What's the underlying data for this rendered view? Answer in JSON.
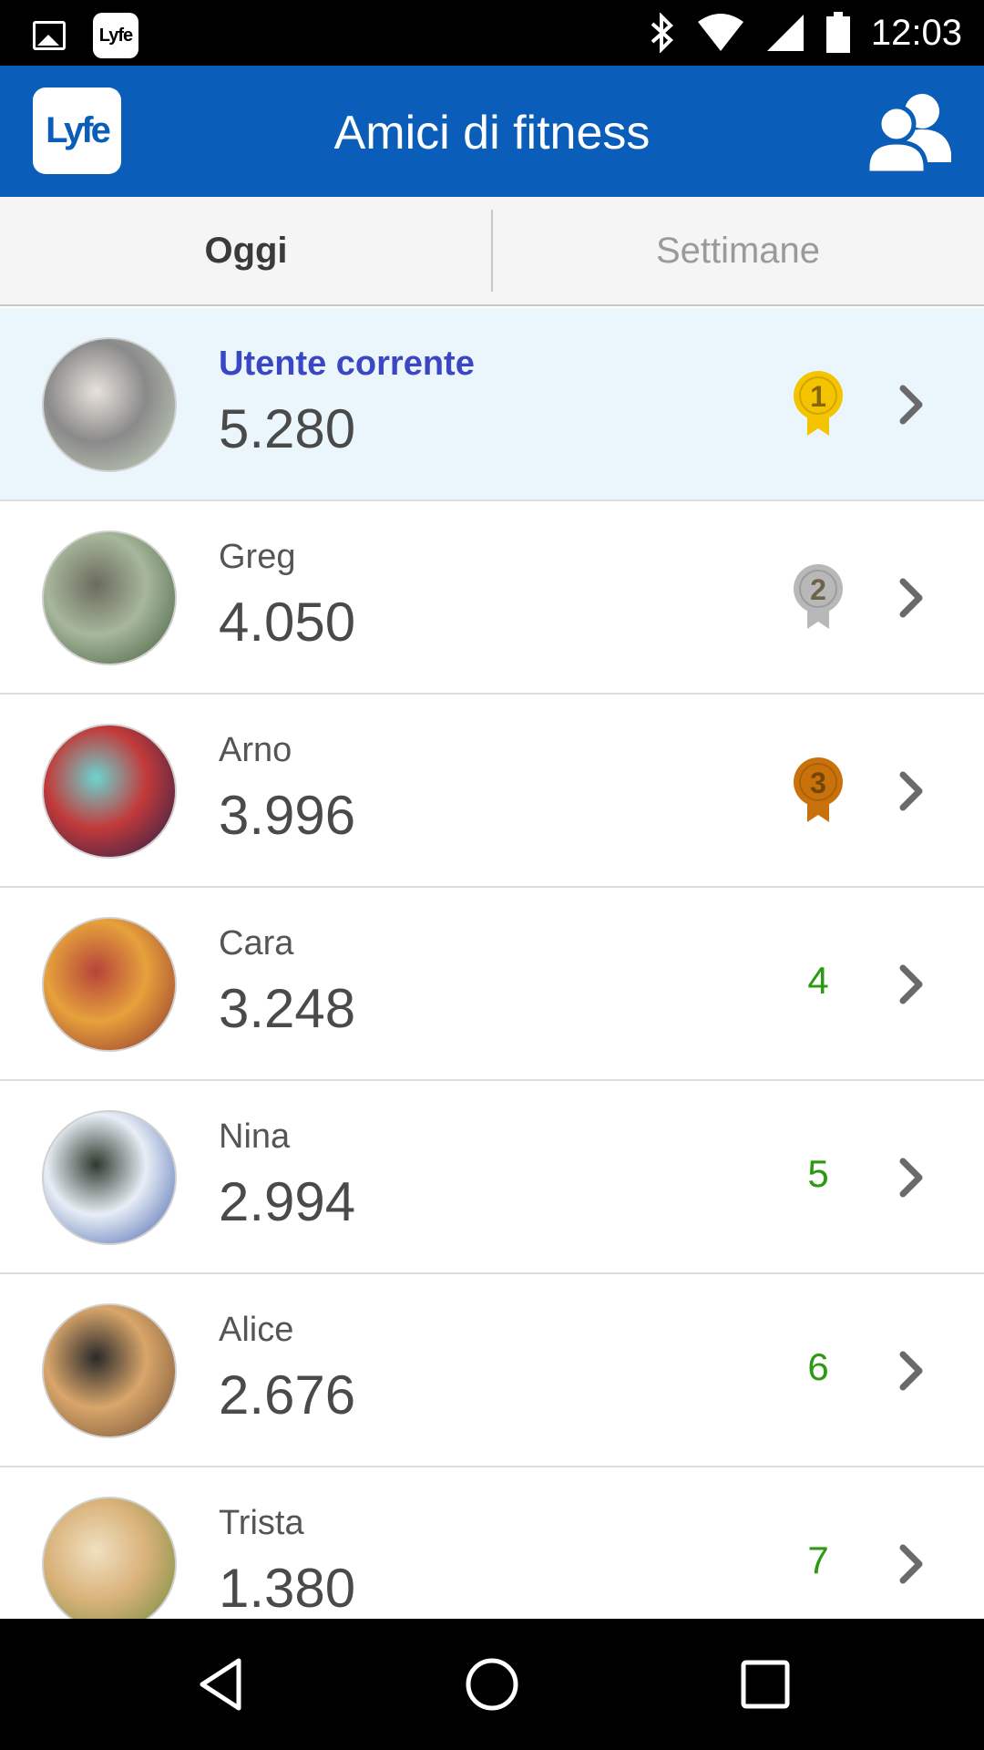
{
  "status_bar": {
    "time": "12:03",
    "app_icon_text": "Lyfe",
    "icons": [
      "image-icon",
      "lyfe-app-icon",
      "bluetooth-icon",
      "wifi-icon",
      "signal-icon",
      "battery-icon"
    ]
  },
  "app_bar": {
    "logo_text": "Lyfe",
    "title": "Amici di fitness",
    "right_icon": "friends-icon"
  },
  "tabs": [
    {
      "label": "Oggi",
      "active": true
    },
    {
      "label": "Settimane",
      "active": false
    }
  ],
  "friends": [
    {
      "name": "Utente corrente",
      "steps": "5.280",
      "rank": "1",
      "medal": "gold",
      "current": true
    },
    {
      "name": "Greg",
      "steps": "4.050",
      "rank": "2",
      "medal": "silver",
      "current": false
    },
    {
      "name": "Arno",
      "steps": "3.996",
      "rank": "3",
      "medal": "bronze",
      "current": false
    },
    {
      "name": "Cara",
      "steps": "3.248",
      "rank": "4",
      "medal": "",
      "current": false
    },
    {
      "name": "Nina",
      "steps": "2.994",
      "rank": "5",
      "medal": "",
      "current": false
    },
    {
      "name": "Alice",
      "steps": "2.676",
      "rank": "6",
      "medal": "",
      "current": false
    },
    {
      "name": "Trista",
      "steps": "1.380",
      "rank": "7",
      "medal": "",
      "current": false
    }
  ],
  "colors": {
    "app_bar": "#0a5db8",
    "current_user_name": "#3b46c4",
    "current_row_bg": "#eaf6fc",
    "rank_green": "#2a9a12",
    "gold": "#f5c400",
    "silver": "#b8b8b8",
    "bronze": "#c9720c"
  },
  "nav_bar": {
    "buttons": [
      "back-icon",
      "home-icon",
      "recents-icon"
    ]
  }
}
